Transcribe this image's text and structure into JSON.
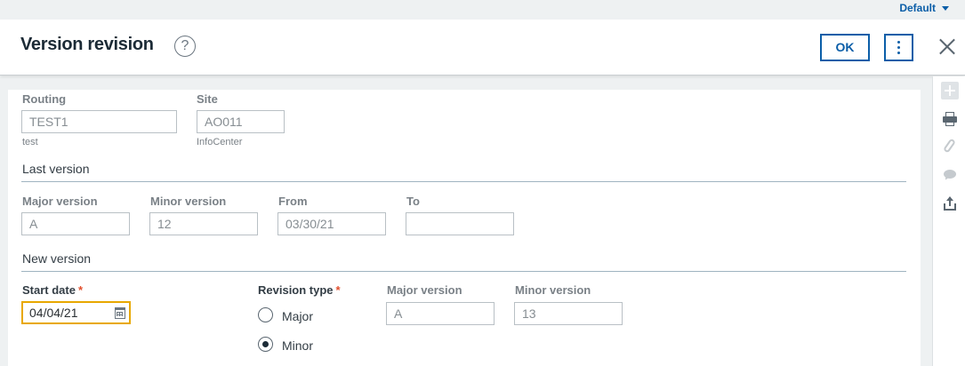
{
  "topbar": {
    "default_label": "Default"
  },
  "header": {
    "title": "Version revision",
    "help_glyph": "?",
    "ok_label": "OK"
  },
  "routing": {
    "label": "Routing",
    "value": "TEST1",
    "description": "test"
  },
  "site": {
    "label": "Site",
    "value": "AO011",
    "description": "InfoCenter"
  },
  "last_version": {
    "heading": "Last version",
    "major_label": "Major version",
    "major_value": "A",
    "minor_label": "Minor version",
    "minor_value": "12",
    "from_label": "From",
    "from_value": "03/30/21",
    "to_label": "To",
    "to_value": ""
  },
  "new_version": {
    "heading": "New version",
    "start_date_label": "Start date",
    "start_date_value": "04/04/21",
    "required_mark": "*",
    "revision_type_label": "Revision type",
    "revision_options": [
      "Major",
      "Minor"
    ],
    "revision_selected": "Minor",
    "major_label": "Major version",
    "major_value": "A",
    "minor_label": "Minor version",
    "minor_value": "13"
  },
  "side_toolbar": {
    "icons": [
      "plus-icon",
      "print-icon",
      "attachment-icon",
      "comment-icon",
      "export-icon"
    ]
  },
  "colors": {
    "accent": "#0b5ea8",
    "focus_border": "#e8a800",
    "required": "#e2502e"
  }
}
